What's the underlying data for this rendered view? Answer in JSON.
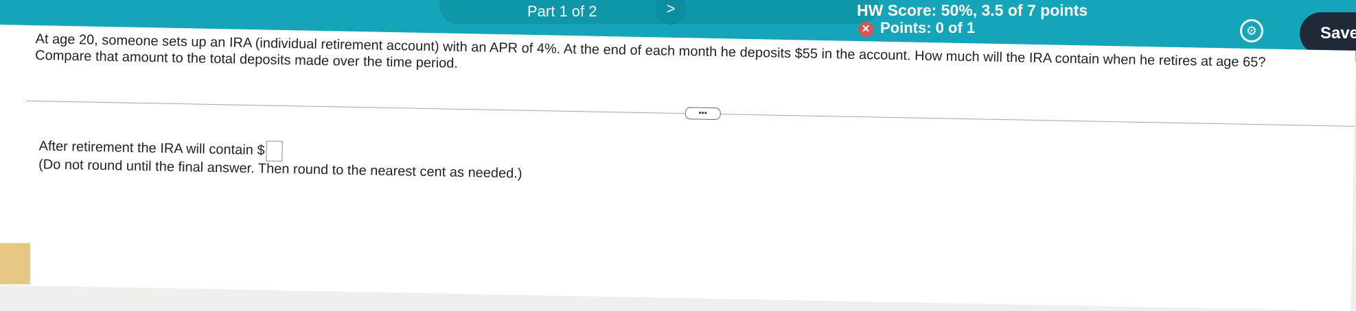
{
  "header": {
    "part": "Part 1 of 2",
    "next_glyph": ">",
    "score": "HW Score: 50%, 3.5 of 7 points",
    "points": "Points: 0 of 1",
    "save": "Save"
  },
  "question": {
    "line1": "At age 20, someone sets up an IRA (individual retirement account) with an APR of 4%. At the end of each month he deposits $55 in the account. How much will the IRA contain when he retires at age 65?",
    "line2": "Compare that amount to the total deposits made over the time period."
  },
  "answer": {
    "prompt": "After retirement the IRA will contain $",
    "note": "(Do not round until the final answer. Then round to the nearest cent as needed.)"
  },
  "icons": {
    "close": "close-icon",
    "gear": "gear-icon",
    "more": "more-dots-icon"
  },
  "colors": {
    "header": "#14a5b8",
    "save": "#1f2937",
    "incorrect": "#d9534f"
  }
}
